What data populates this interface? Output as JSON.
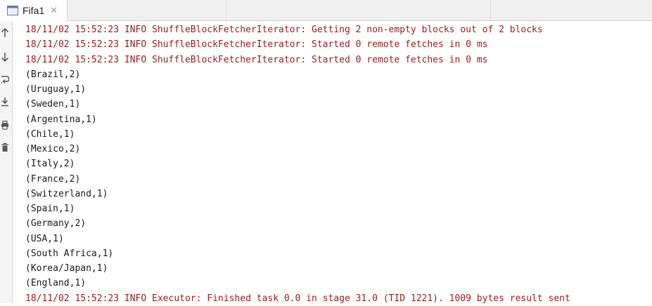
{
  "tab": {
    "label": "Fifa1",
    "close_glyph": "✕"
  },
  "toolbar": {
    "icons": [
      "up-arrow-icon",
      "down-arrow-icon",
      "soft-wrap-icon",
      "scroll-to-end-icon",
      "print-icon",
      "trash-icon"
    ]
  },
  "console": {
    "lines": [
      {
        "text": "18/11/02 15:52:23 INFO ShuffleBlockFetcherIterator: Getting 2 non-empty blocks out of 2 blocks",
        "type": "log"
      },
      {
        "text": "18/11/02 15:52:23 INFO ShuffleBlockFetcherIterator: Started 0 remote fetches in 0 ms",
        "type": "log"
      },
      {
        "text": "18/11/02 15:52:23 INFO ShuffleBlockFetcherIterator: Started 0 remote fetches in 0 ms",
        "type": "log"
      },
      {
        "text": "(Brazil,2)",
        "type": "out"
      },
      {
        "text": "(Uruguay,1)",
        "type": "out"
      },
      {
        "text": "(Sweden,1)",
        "type": "out"
      },
      {
        "text": "(Argentina,1)",
        "type": "out"
      },
      {
        "text": "(Chile,1)",
        "type": "out"
      },
      {
        "text": "(Mexico,2)",
        "type": "out"
      },
      {
        "text": "(Italy,2)",
        "type": "out"
      },
      {
        "text": "(France,2)",
        "type": "out"
      },
      {
        "text": "(Switzerland,1)",
        "type": "out"
      },
      {
        "text": "(Spain,1)",
        "type": "out"
      },
      {
        "text": "(Germany,2)",
        "type": "out"
      },
      {
        "text": "(USA,1)",
        "type": "out"
      },
      {
        "text": "(South Africa,1)",
        "type": "out"
      },
      {
        "text": "(Korea/Japan,1)",
        "type": "out"
      },
      {
        "text": "(England,1)",
        "type": "out"
      },
      {
        "text": "18/11/02 15:52:23 INFO Executor: Finished task 0.0 in stage 31.0 (TID 1221). 1009 bytes result sent",
        "type": "log"
      }
    ]
  },
  "colors": {
    "log": "#9c1b1b",
    "output": "#1a1a1a",
    "tab_bg": "#ffffff",
    "bar_bg": "#f0f0f0"
  }
}
